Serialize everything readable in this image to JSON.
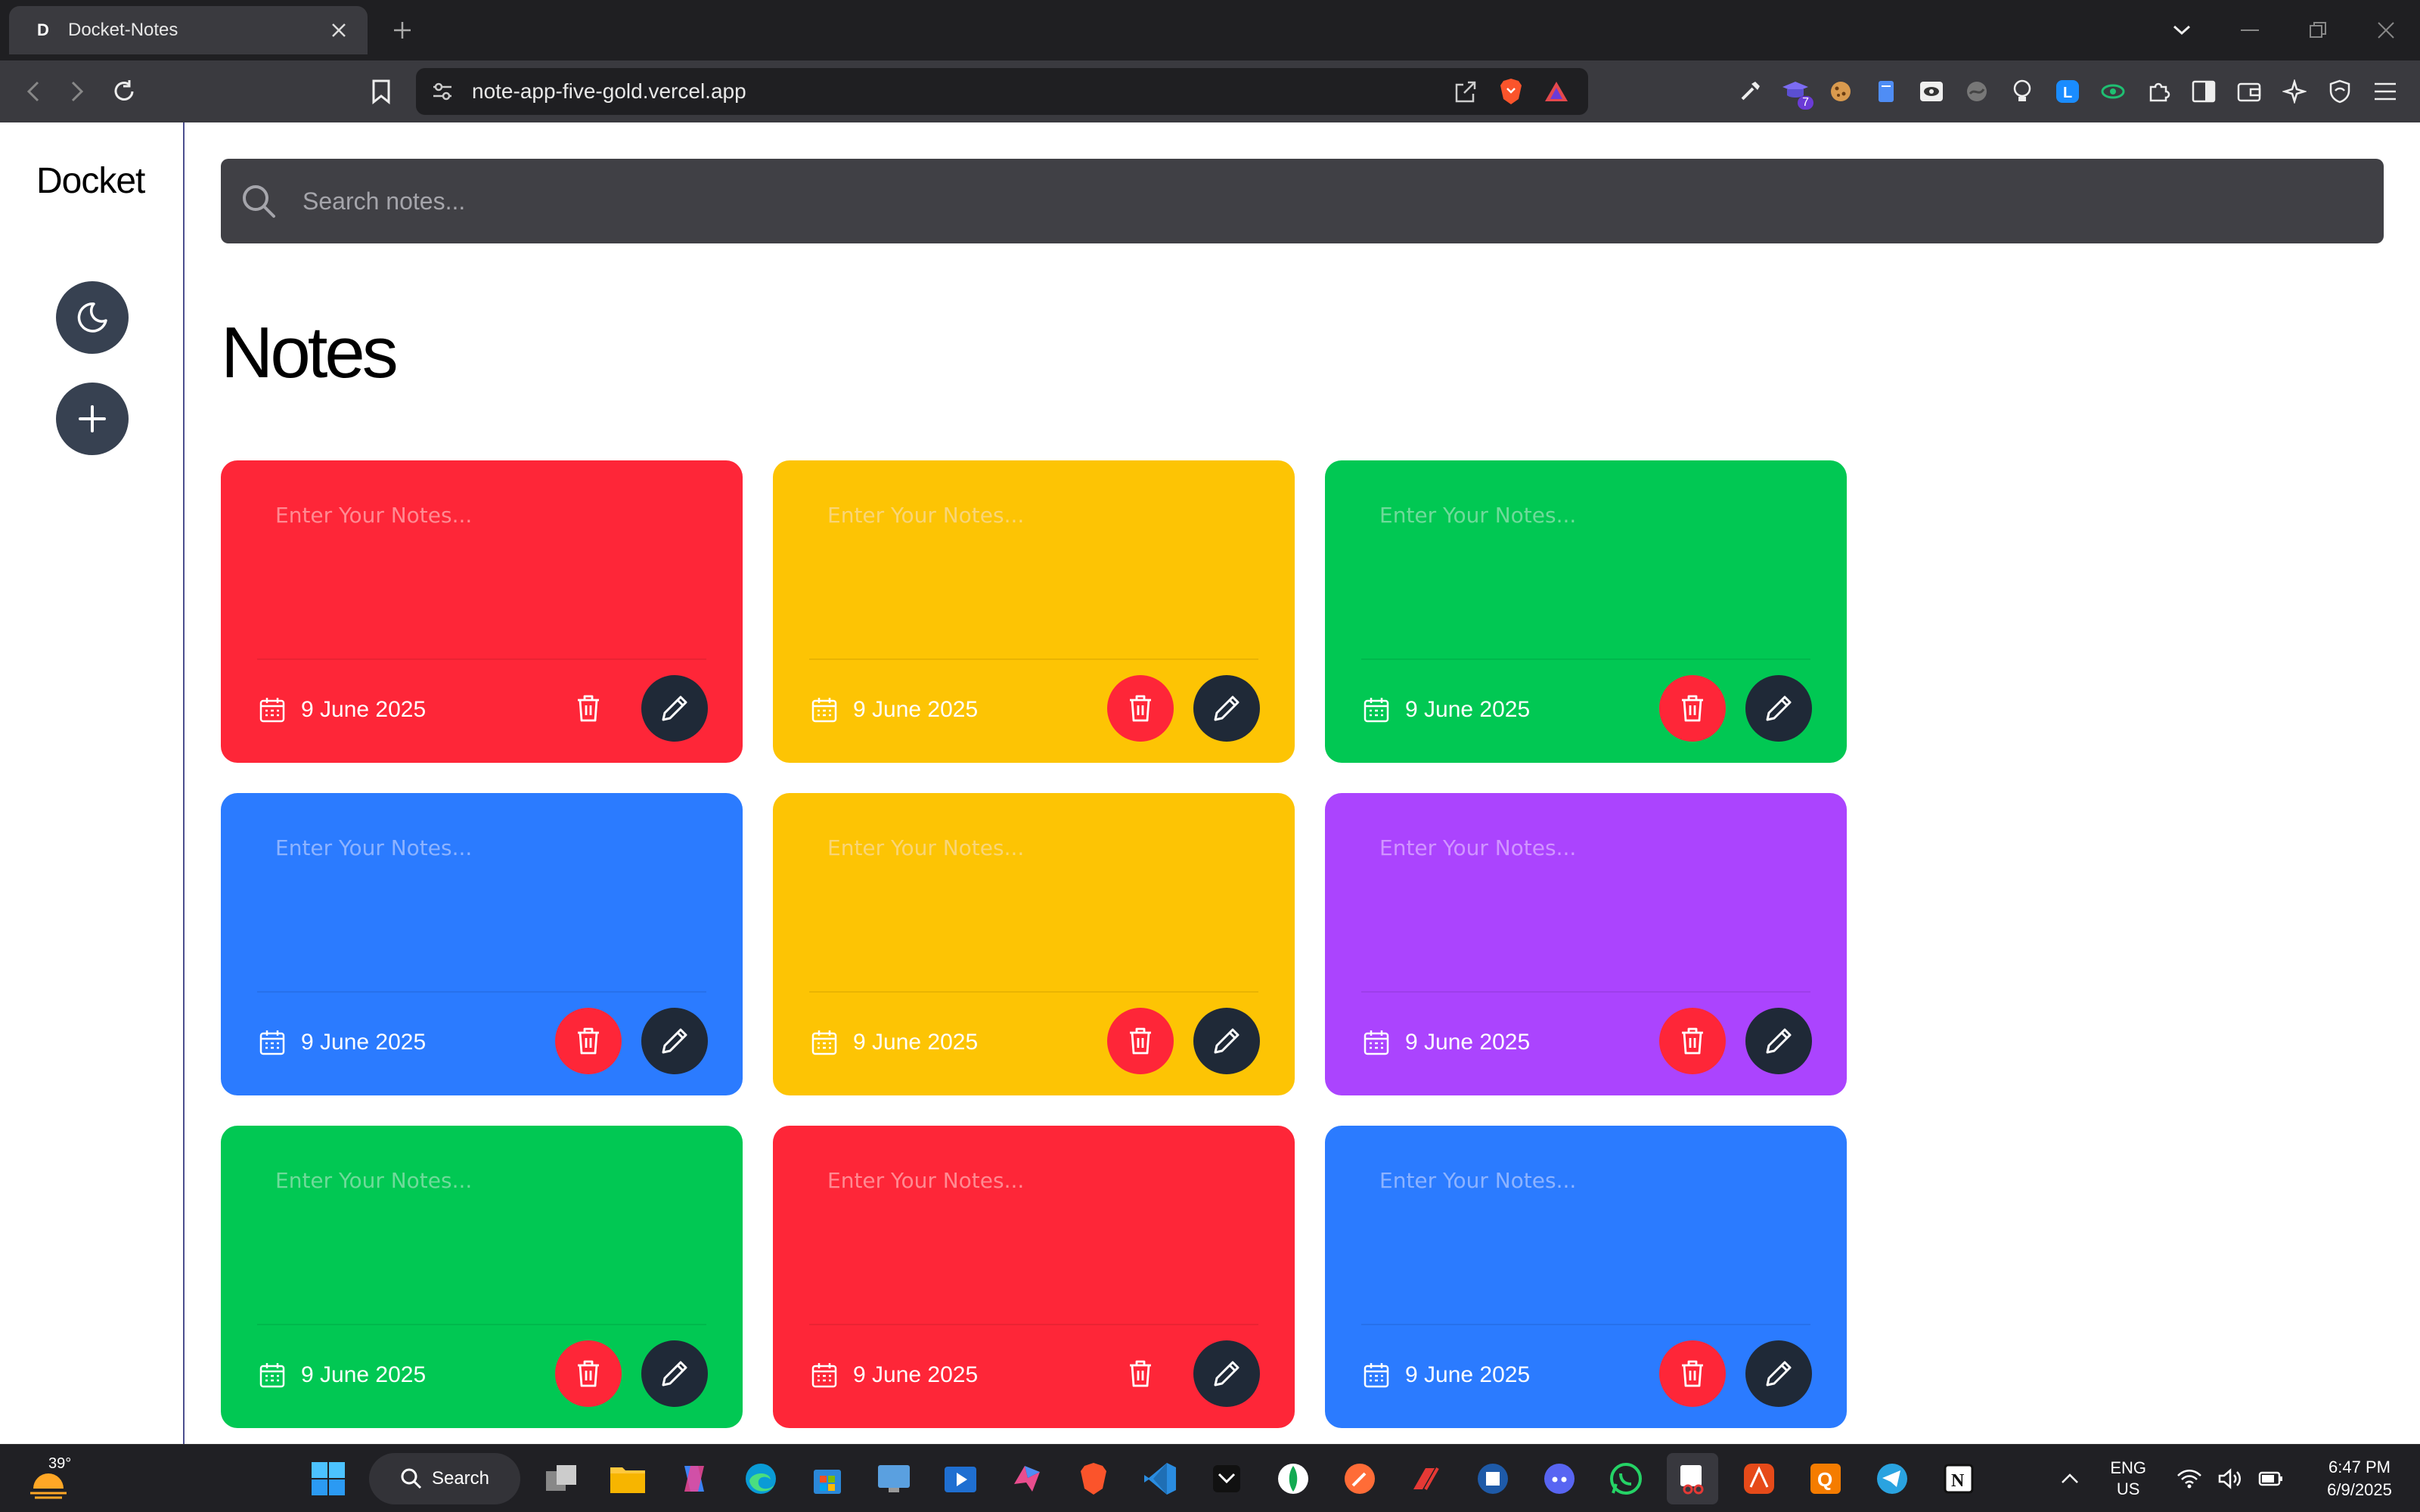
{
  "browser": {
    "tab_title": "Docket-Notes",
    "tab_favicon_letter": "D",
    "url": "note-app-five-gold.vercel.app",
    "extensions_badge": "7"
  },
  "app": {
    "brand": "Docket",
    "search_placeholder": "Search notes...",
    "heading": "Notes",
    "note_placeholder": "Enter Your Notes...",
    "notes": [
      {
        "color": "red",
        "date": "9 June 2025"
      },
      {
        "color": "yellow",
        "date": "9 June 2025"
      },
      {
        "color": "green",
        "date": "9 June 2025"
      },
      {
        "color": "blue",
        "date": "9 June 2025"
      },
      {
        "color": "yellow",
        "date": "9 June 2025"
      },
      {
        "color": "purple",
        "date": "9 June 2025"
      },
      {
        "color": "green",
        "date": "9 June 2025"
      },
      {
        "color": "red",
        "date": "9 June 2025"
      },
      {
        "color": "blue",
        "date": "9 June 2025"
      }
    ],
    "colors": {
      "red": "#fe2638",
      "yellow": "#fdc404",
      "green": "#01c853",
      "blue": "#2b7bff",
      "purple": "#ab44fe",
      "dark_button": "#1f2937"
    }
  },
  "taskbar": {
    "weather_temp": "39°",
    "search_label": "Search",
    "lang_line1": "ENG",
    "lang_line2": "US",
    "time": "6:47 PM",
    "date": "6/9/2025"
  }
}
